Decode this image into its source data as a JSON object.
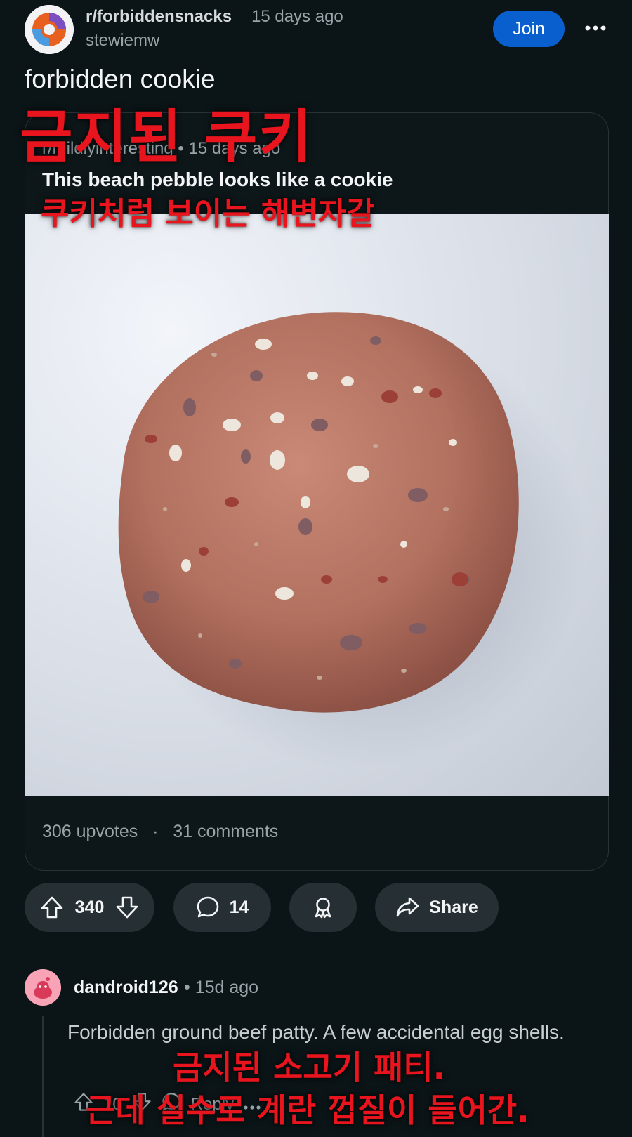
{
  "post": {
    "subreddit": "r/forbiddensnacks",
    "time": "15 days ago",
    "author": "stewiemw",
    "join_label": "Join",
    "title": "forbidden cookie",
    "title_overlay": "금지된 쿠키"
  },
  "crosspost": {
    "meta": "r/mildlyinteresting • 15 days ago",
    "title": "This beach pebble looks like a cookie",
    "title_overlay": "쿠키처럼 보이는 해변자갈",
    "upvotes": "306 upvotes",
    "comments": "31 comments"
  },
  "actions": {
    "score": "340",
    "comment_count": "14",
    "share_label": "Share"
  },
  "comment": {
    "author": "dandroid126",
    "time": "15d ago",
    "body": "Forbidden ground beef patty. A few accidental egg shells.",
    "overlay_line1": "금지된 소고기 패티.",
    "overlay_line2": "근데 실수로 계란 껍질이 들어간.",
    "score": "10",
    "reply_label": "Reply"
  },
  "icons": {
    "more": "more-dots-icon",
    "upvote": "upvote-arrow-icon",
    "downvote": "downvote-arrow-icon",
    "comment": "comment-bubble-icon",
    "award": "award-ribbon-icon",
    "share": "share-arrow-icon"
  },
  "colors": {
    "background": "#0b1416",
    "join": "#0a5fcf",
    "pill": "#262f33",
    "overlay_text": "#e8141e"
  }
}
